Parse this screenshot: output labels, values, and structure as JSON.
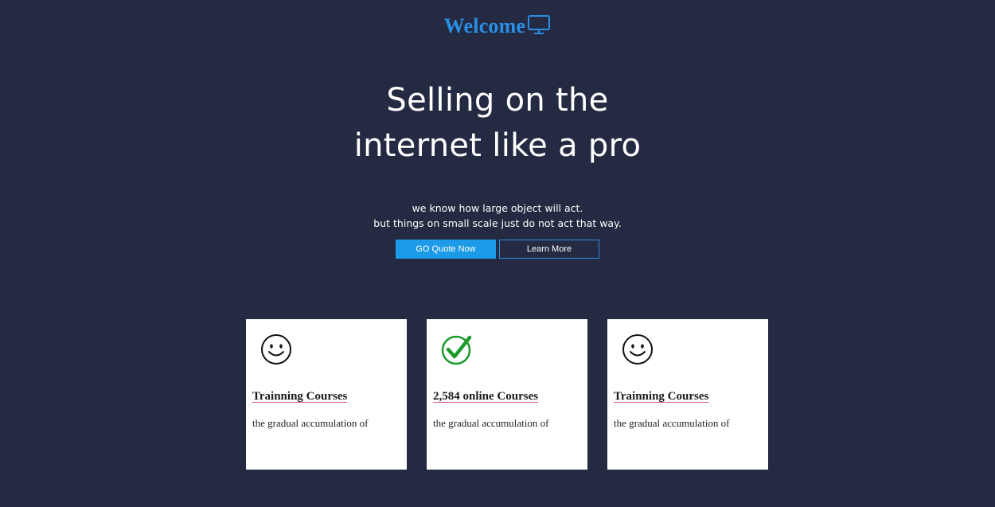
{
  "brand": {
    "title": "Welcome",
    "icon": "monitor-icon",
    "color": "#2a8ee3"
  },
  "hero": {
    "headline_line1": "Selling on the",
    "headline_line2": "internet like a pro",
    "sub_line1": "we know how large object will act.",
    "sub_line2": "but things on small scale just do not act that way."
  },
  "actions": {
    "primary_label": "GO Quote Now",
    "secondary_label": "Learn More"
  },
  "cards": [
    {
      "icon": "smiley-icon",
      "title": "Trainning Courses",
      "text": "the gradual accumulation of"
    },
    {
      "icon": "checkmark-icon",
      "title": "2,584 online Courses",
      "text": "the gradual accumulation of"
    },
    {
      "icon": "smiley-icon",
      "title": "Trainning Courses",
      "text": "the gradual accumulation of"
    }
  ],
  "colors": {
    "background": "#252a43",
    "accent": "#1e9be8",
    "check_green": "#1a9a2a"
  }
}
